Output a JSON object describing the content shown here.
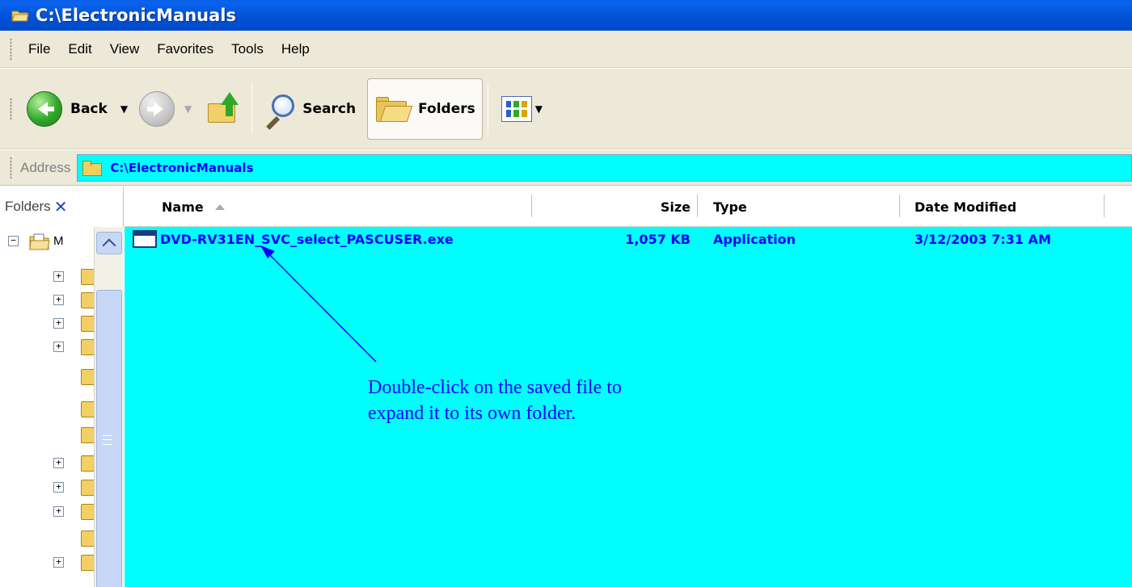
{
  "window": {
    "title": "C:\\ElectronicManuals"
  },
  "menu": [
    "File",
    "Edit",
    "View",
    "Favorites",
    "Tools",
    "Help"
  ],
  "toolbar": {
    "back_label": "Back",
    "search_label": "Search",
    "folders_label": "Folders"
  },
  "address": {
    "label": "Address",
    "value": "C:\\ElectronicManuals"
  },
  "folders_pane": {
    "title": "Folders",
    "root_label_fragment": "M"
  },
  "columns": {
    "name": "Name",
    "size": "Size",
    "type": "Type",
    "date": "Date Modified"
  },
  "files": [
    {
      "name": "DVD-RV31EN_SVC_select_PASCUSER.exe",
      "size": "1,057 KB",
      "type": "Application",
      "date": "3/12/2003 7:31 AM"
    }
  ],
  "annotation": {
    "line1": "Double-click on the saved file to",
    "line2": "expand it to its own folder."
  },
  "colors": {
    "highlight_background": "#00ffff",
    "annotation_text": "#0000ff",
    "titlebar": "#0254d8"
  }
}
